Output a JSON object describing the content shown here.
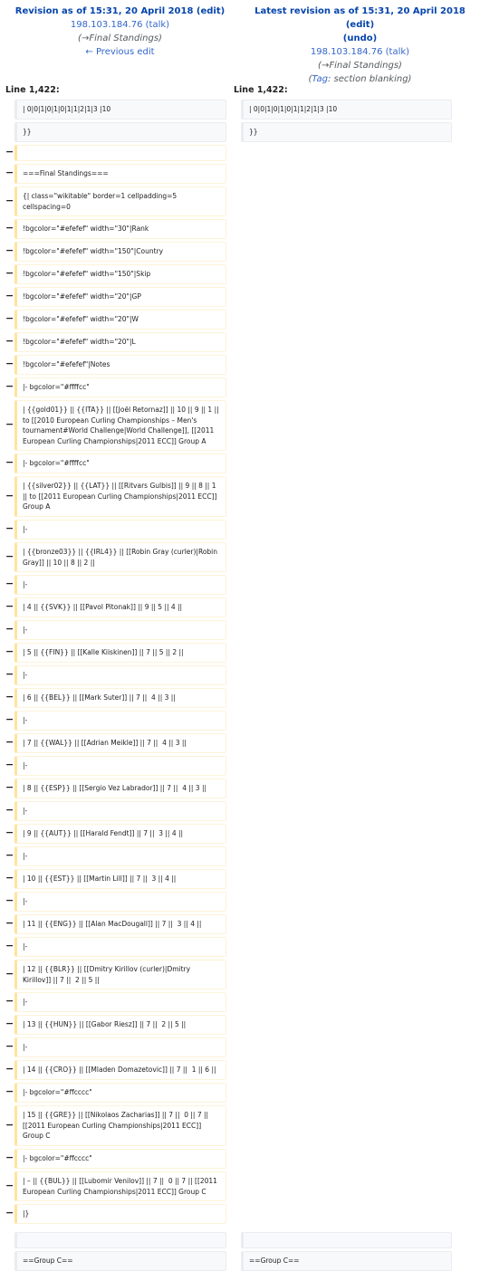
{
  "header": {
    "left": {
      "title": "Revision as of 15:31, 20 April 2018",
      "edit": "(edit)",
      "user": "198.103.184.76",
      "talk": "(talk)",
      "comment_arrow": "(→",
      "comment": "Final Standings",
      "comment_end": ")",
      "prev_link": "← Previous edit"
    },
    "right": {
      "title": "Latest revision as of 15:31, 20 April 2018",
      "edit": "(edit)",
      "undo": "(undo)",
      "user": "198.103.184.76",
      "talk": "(talk)",
      "comment_arrow": "(→",
      "comment": "Final Standings",
      "comment_end": ")",
      "tag_open": "(",
      "tag_label": "Tag",
      "tag_rest": ": section blanking)"
    }
  },
  "line_left": "Line 1,422:",
  "line_right": "Line 1,422:",
  "minus": "−",
  "context_top": [
    "| 0|0|1|0|1|0|1|1|2|1|3 |10",
    "}}"
  ],
  "deleted": [
    "",
    "===Final Standings===",
    "{| class=\"wikitable\" border=1 cellpadding=5 cellspacing=0",
    "!bgcolor=\"#efefef\" width=\"30\"|Rank",
    "!bgcolor=\"#efefef\" width=\"150\"|Country",
    "!bgcolor=\"#efefef\" width=\"150\"|Skip",
    "!bgcolor=\"#efefef\" width=\"20\"|GP",
    "!bgcolor=\"#efefef\" width=\"20\"|W",
    "!bgcolor=\"#efefef\" width=\"20\"|L",
    "!bgcolor=\"#efefef\"|Notes",
    "|- bgcolor=\"#ffffcc\"",
    "| {{gold01}} || {{ITA}} || [[Joël Retornaz]] || 10 || 9 || 1 || to [[2010 European Curling Championships – Men's tournament#World Challenge|World Challenge]], [[2011 European Curling Championships|2011 ECC]] Group A",
    "|- bgcolor=\"#ffffcc\"",
    "| {{silver02}} || {{LAT}} || [[Ritvars Gulbis]] || 9 || 8 || 1 || to [[2011 European Curling Championships|2011 ECC]] Group A",
    "|-",
    "| {{bronze03}} || {{IRL4}} || [[Robin Gray (curler)|Robin Gray]] || 10 || 8 || 2 ||",
    "|-",
    "| 4 || {{SVK}} || [[Pavol Pitonak]] || 9 || 5 || 4 ||",
    "|-",
    "| 5 || {{FIN}} || [[Kalle Kiiskinen]] || 7 || 5 || 2 ||",
    "|-",
    "| 6 || {{BEL}} || [[Mark Suter]] || 7 ||  4 || 3 ||",
    "|-",
    "| 7 || {{WAL}} || [[Adrian Meikle]] || 7 ||  4 || 3 ||",
    "|-",
    "| 8 || {{ESP}} || [[Sergio Vez Labrador]] || 7 ||  4 || 3 ||",
    "|-",
    "| 9 || {{AUT}} || [[Harald Fendt]] || 7 ||  3 || 4 ||",
    "|-",
    "| 10 || {{EST}} || [[Martin Lill]] || 7 ||  3 || 4 ||",
    "|-",
    "| 11 || {{ENG}} || [[Alan MacDougall]] || 7 ||  3 || 4 ||",
    "|-",
    "| 12 || {{BLR}} || [[Dmitry Kirillov (curler)|Dmitry Kirillov]] || 7 ||  2 || 5 ||",
    "|-",
    "| 13 || {{HUN}} || [[Gabor Riesz]] || 7 ||  2 || 5 ||",
    "|-",
    "| 14 || {{CRO}} || [[Mladen Domazetovic]] || 7 ||  1 || 6 ||",
    "|- bgcolor=\"#ffcccc\"",
    "| 15 || {{GRE}} || [[Nikolaos Zacharias]] || 7 ||  0 || 7 || [[2011 European Curling Championships|2011 ECC]] Group C",
    "|- bgcolor=\"#ffcccc\"",
    "| – || {{BUL}} || [[Lubomir Venilov]] || 7 ||  0 || 7 || [[2011 European Curling Championships|2011 ECC]] Group C",
    "|}"
  ],
  "context_bottom": [
    "",
    "==Group C=="
  ],
  "colors": {
    "link": "#3366cc",
    "deleted_border": "#ffe49c",
    "context_bg": "#f8f9fa"
  }
}
